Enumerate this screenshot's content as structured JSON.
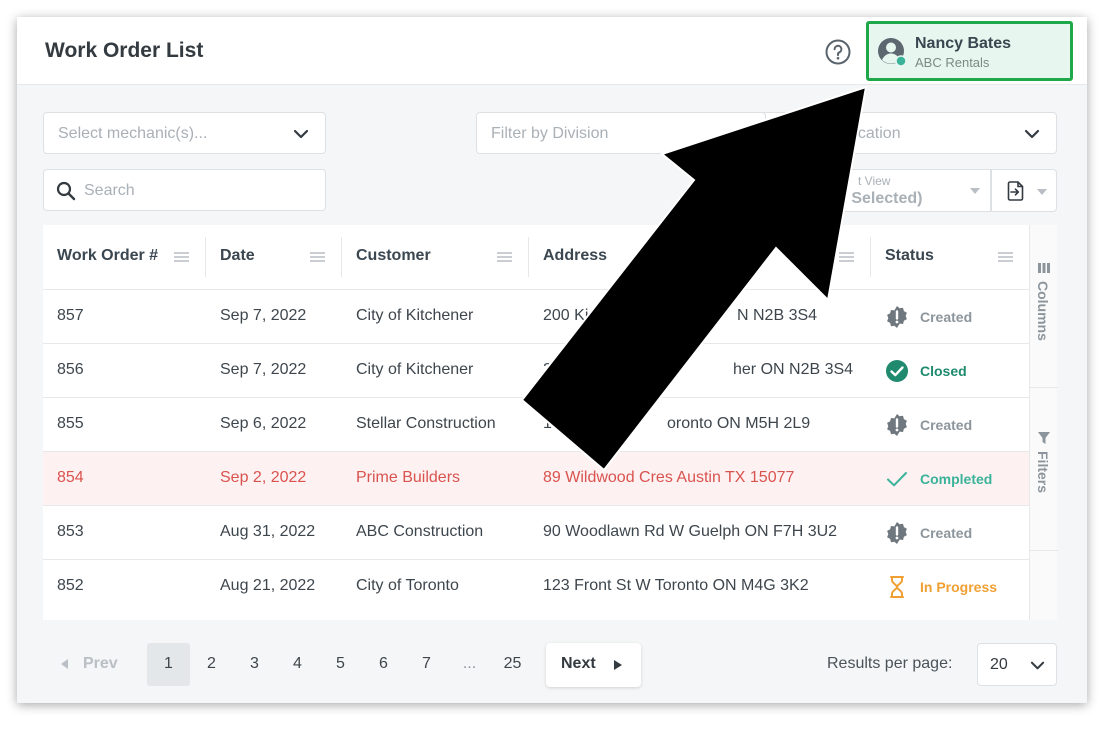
{
  "header": {
    "title": "Work Order List",
    "user_name": "Nancy Bates",
    "user_org": "ABC Rentals"
  },
  "filters": {
    "mechanic_placeholder": "Select mechanic(s)...",
    "division_placeholder": "Filter by Division",
    "location_placeholder": "ocation",
    "search_placeholder": "Search",
    "view_label": "t View",
    "view_value": "e Selected)"
  },
  "table": {
    "columns": [
      "Work Order #",
      "Date",
      "Customer",
      "Address",
      "Status"
    ],
    "rows": [
      {
        "id": "857",
        "date": "Sep 7, 2022",
        "customer": "City of Kitchener",
        "address": "200 Ki",
        "address_tail": "N N2B 3S4",
        "status": "Created"
      },
      {
        "id": "856",
        "date": "Sep 7, 2022",
        "customer": "City of Kitchener",
        "address": "2",
        "address_tail": "her ON N2B 3S4",
        "status": "Closed"
      },
      {
        "id": "855",
        "date": "Sep 6, 2022",
        "customer": "Stellar Construction",
        "address": "1",
        "address_tail": "oronto ON M5H 2L9",
        "status": "Created"
      },
      {
        "id": "854",
        "date": "Sep 2, 2022",
        "customer": "Prime Builders",
        "address": "89 Wildwood Cres Austin TX 15077",
        "address_tail": "",
        "status": "Completed"
      },
      {
        "id": "853",
        "date": "Aug 31, 2022",
        "customer": "ABC Construction",
        "address": "90 Woodlawn Rd W Guelph ON F7H 3U2",
        "address_tail": "",
        "status": "Created"
      },
      {
        "id": "852",
        "date": "Aug 21, 2022",
        "customer": "City of Toronto",
        "address": "123 Front St W Toronto ON M4G 3K2",
        "address_tail": "",
        "status": "In Progress"
      }
    ]
  },
  "side_panel": {
    "columns_label": "Columns",
    "filters_label": "Filters"
  },
  "pagination": {
    "prev_label": "Prev",
    "next_label": "Next",
    "pages": [
      "1",
      "2",
      "3",
      "4",
      "5",
      "6",
      "7",
      "...",
      "25"
    ],
    "current_page": "1",
    "results_per_page_label": "Results per page:",
    "results_per_page_value": "20"
  },
  "colors": {
    "accent_green": "#1fa84a",
    "status_created": "#8c959c",
    "status_closed": "#1f8a6e",
    "status_completed": "#3bb39b",
    "status_in_progress": "#f0a033",
    "highlight_row_text": "#d9534f"
  },
  "icons": [
    "help-circle-icon",
    "user-avatar-icon",
    "chevron-down-icon",
    "search-icon",
    "export-file-icon",
    "column-menu-icon",
    "columns-icon",
    "filter-icon",
    "alert-badge-icon",
    "check-circle-icon",
    "checkmark-icon",
    "hourglass-icon"
  ]
}
